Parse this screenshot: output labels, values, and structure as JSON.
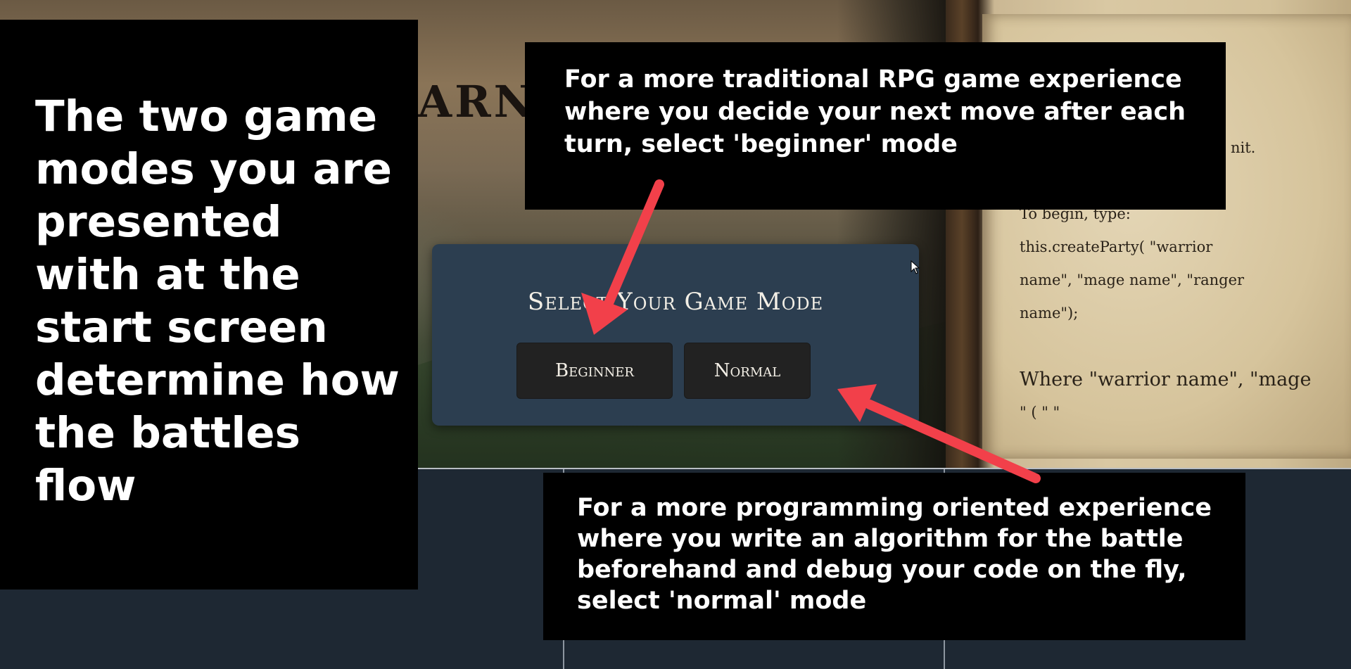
{
  "background": {
    "title_fragment": "ARN",
    "book_lines": [
      "",
      "",
      "",
      "nit.",
      "",
      "To begin, type:",
      "this.createParty( \"warrior",
      "name\", \"mage name\", \"ranger",
      "name\");",
      "",
      "Where \"warrior name\", \"mage",
      "\"      ( \"              \""
    ]
  },
  "mode_dialog": {
    "title": "Select Your Game Mode",
    "beginner_label": "Beginner",
    "normal_label": "Normal"
  },
  "annotations": {
    "left_note": "The two game modes you are presented with at the start screen determine how the battles flow",
    "top_note": "For a more traditional RPG game experience where you decide your next move after each turn, select 'beginner' mode",
    "bottom_note": "For a more programming oriented experience where you write an algorithm for the battle beforehand and debug your code on the fly, select 'normal' mode"
  },
  "colors": {
    "arrow": "#f2404a",
    "dialog_bg": "#2c3e50",
    "button_bg": "#222222",
    "bottom_panel": "#1e2833"
  },
  "icons": {
    "cursor": "cursor-arrow-icon"
  }
}
